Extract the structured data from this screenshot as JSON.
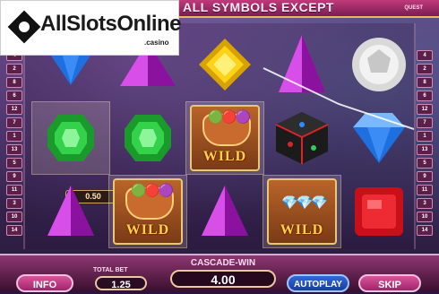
{
  "logo": {
    "brand": "AllSlotsOnline",
    "tld": ".casino"
  },
  "banner": {
    "text": "ALL SYMBOLS EXCEPT",
    "quest": "QUEST"
  },
  "paylines": {
    "left": [
      "4",
      "2",
      "8",
      "6",
      "12",
      "7",
      "1",
      "13",
      "5",
      "9",
      "11",
      "3",
      "10",
      "14"
    ],
    "right": [
      "4",
      "2",
      "8",
      "6",
      "12",
      "7",
      "1",
      "13",
      "5",
      "9",
      "11",
      "3",
      "10",
      "14"
    ]
  },
  "reels": [
    [
      "diamond-blue",
      "gem-green",
      "triangle-purple"
    ],
    [
      "triangle-purple",
      "gem-green",
      "wild-pot"
    ],
    [
      "gem-yellow",
      "wild-pot",
      "triangle-purple"
    ],
    [
      "triangle-purple",
      "dice-black",
      "wild-chest"
    ],
    [
      "orb-white",
      "diamond-blue",
      "cube-red"
    ]
  ],
  "wild_text": "WILD",
  "win_amount": "0.50",
  "bottom": {
    "info_label": "INFO",
    "total_bet_label": "TOTAL BET",
    "total_bet_value": "1.25",
    "cascade_label": "CASCADE-WIN",
    "cascade_value": "4.00",
    "autoplay_label": "AUTOPLAY",
    "skip_label": "SKIP"
  },
  "colors": {
    "accent_pink": "#c03a7a",
    "wild_gold": "#ffd24a",
    "autoplay_blue": "#2f6ad8"
  }
}
